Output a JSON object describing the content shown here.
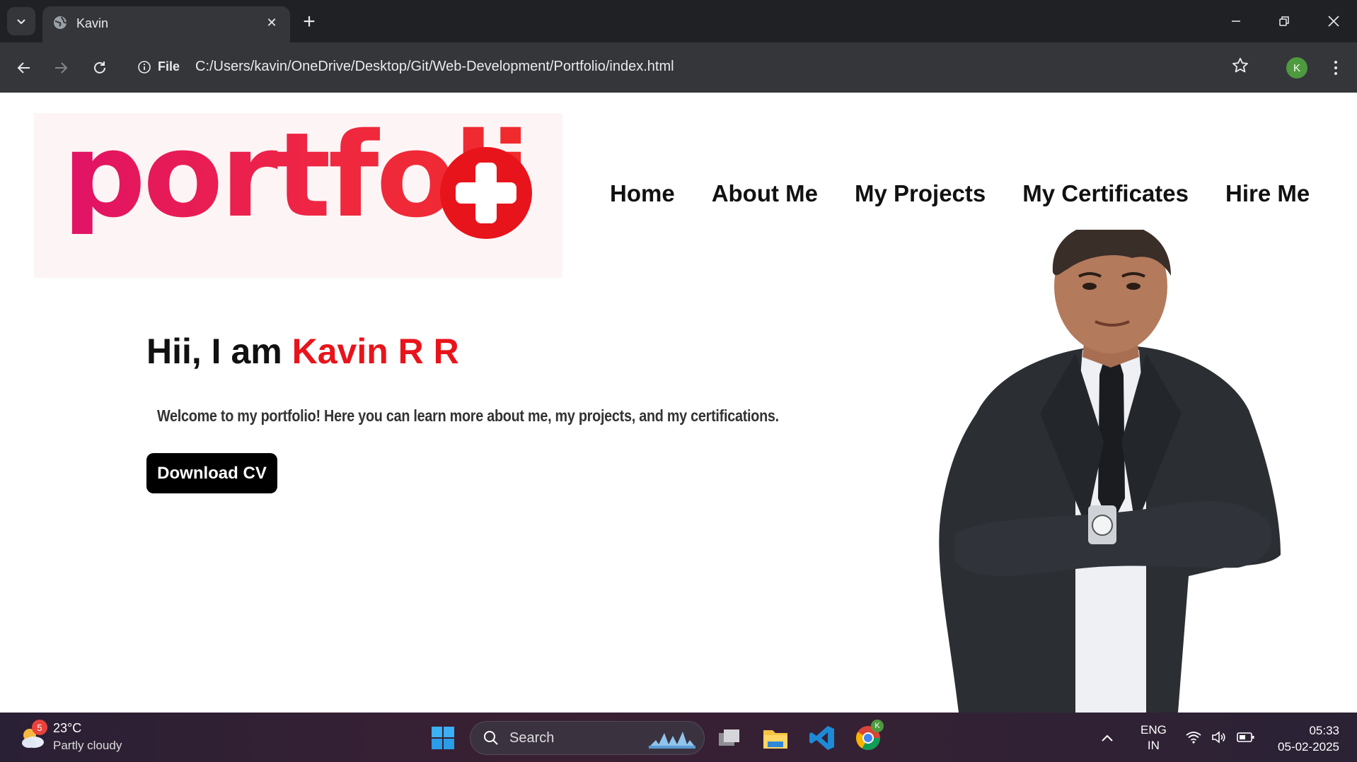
{
  "browser": {
    "tab_title": "Kavin",
    "url_scheme_label": "File",
    "url": "C:/Users/kavin/OneDrive/Desktop/Git/Web-Development/Portfolio/index.html",
    "profile_initial": "K"
  },
  "page": {
    "logo_text": "portfoli",
    "nav": [
      "Home",
      "About Me",
      "My Projects",
      "My Certificates",
      "Hire Me"
    ],
    "hero_prefix": "Hii, I am ",
    "hero_name": "Kavin R R",
    "welcome": "Welcome to my portfolio! Here you can learn more about me, my projects, and my certifications.",
    "cv_button": "Download CV",
    "colors": {
      "accent": "#e8141c",
      "logo_pink": "#e11267"
    }
  },
  "taskbar": {
    "weather_badge": "5",
    "temperature": "23°C",
    "condition": "Partly cloudy",
    "search_placeholder": "Search",
    "language_line1": "ENG",
    "language_line2": "IN",
    "time": "05:33",
    "date": "05-02-2025",
    "chrome_badge": "K"
  }
}
